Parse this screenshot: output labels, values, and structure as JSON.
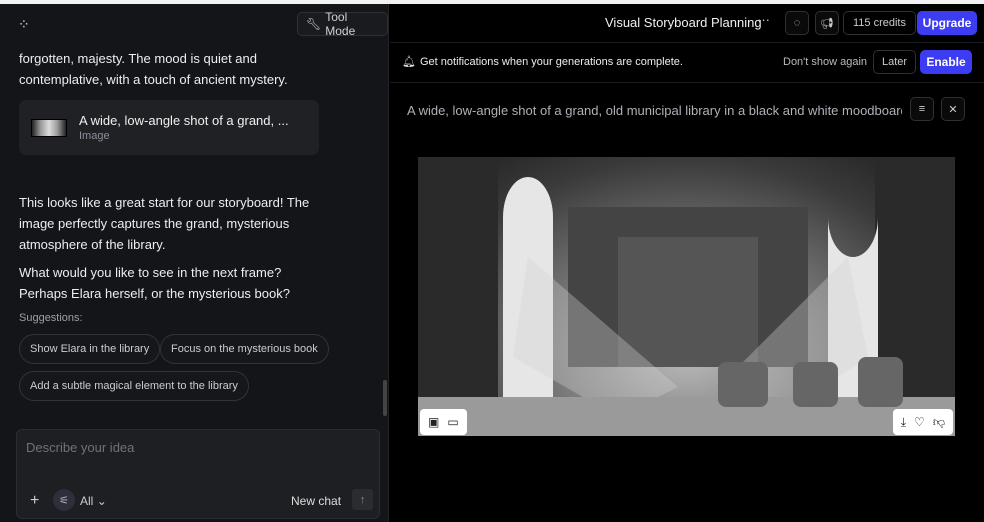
{
  "left": {
    "tool_mode": "Tool Mode",
    "msg1": "forgotten, majesty. The mood is quiet and contemplative, with a touch of ancient mystery.",
    "card": {
      "title": "A wide, low-angle shot of a grand, ...",
      "type": "Image"
    },
    "msg2": "This looks like a great start for our storyboard! The image perfectly captures the grand, mysterious atmosphere of the library.",
    "msg3": "What would you like to see in the next frame? Perhaps Elara herself, or the mysterious book?",
    "suggestions_label": "Suggestions:",
    "suggestions": [
      "Show Elara in the library",
      "Focus on the mysterious book",
      "Add a subtle magical element to the library"
    ],
    "composer": {
      "placeholder": "Describe your idea",
      "filter": "All",
      "new_chat": "New chat"
    }
  },
  "header": {
    "title": "Visual Storyboard Planning",
    "credits": "115 credits",
    "upgrade": "Upgrade"
  },
  "notification": {
    "text": "Get notifications when your generations are complete.",
    "dont_show": "Don't show again",
    "later": "Later",
    "enable": "Enable"
  },
  "prompt": "A wide, low-angle shot of a grand, old municipal library in a black and white moodboard sk..."
}
